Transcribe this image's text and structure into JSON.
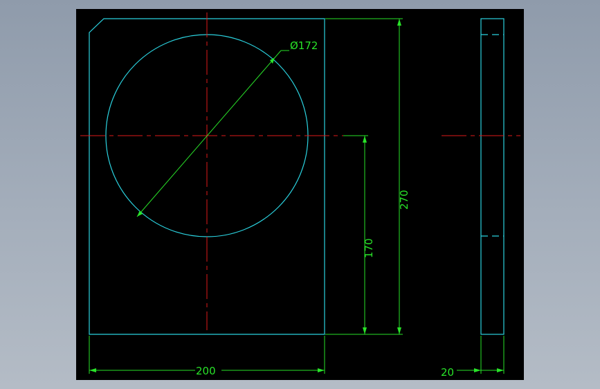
{
  "colors": {
    "background": "#000000",
    "outline": "#2bd3e0",
    "centerline": "#e01a1a",
    "dimension": "#29e329"
  },
  "dimensions": {
    "diameter": "Ø172",
    "height_total": "270",
    "height_center": "170",
    "width": "200",
    "thickness": "20"
  }
}
